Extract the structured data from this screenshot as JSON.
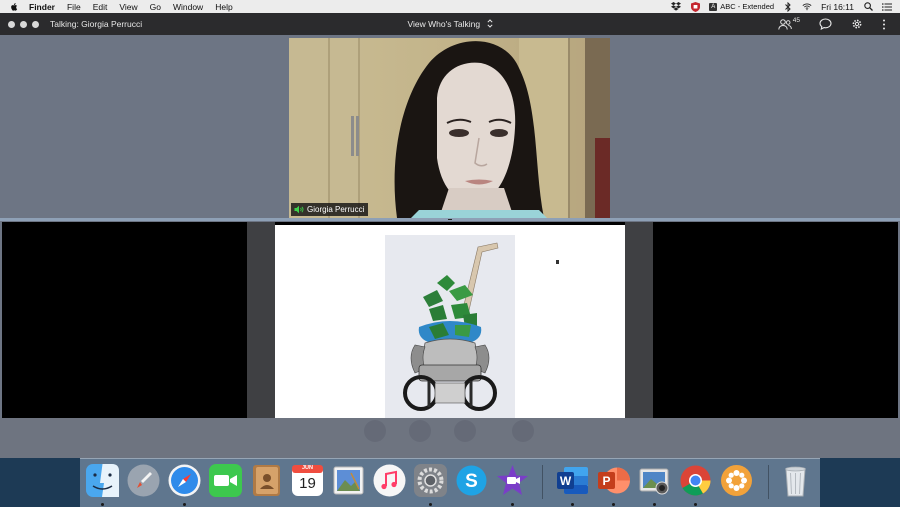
{
  "menubar": {
    "app_name": "Finder",
    "items": [
      "File",
      "Edit",
      "View",
      "Go",
      "Window",
      "Help"
    ],
    "input_source": "ABC - Extended",
    "input_badge": "A",
    "clock": "Fri 16:11"
  },
  "window": {
    "talking_label": "Talking: Giorgia Perrucci",
    "view_mode": "View Who's Talking",
    "participants_count": "45"
  },
  "speaker": {
    "name": "Giorgia Perrucci"
  },
  "calendar_icon": {
    "month": "JUN",
    "day": "19"
  },
  "colors": {
    "titlebar": "#2b2b2d",
    "window_bg": "#6d7584",
    "divider": "#8ea0b6",
    "speaking_green": "#3fd14b"
  },
  "dock": {
    "apps": [
      "finder-icon",
      "launchpad-icon",
      "safari-icon",
      "facetime-icon",
      "contacts-icon",
      "calendar-icon",
      "preview-icon",
      "music-icon",
      "system-preferences-icon",
      "skype-icon",
      "imovie-icon",
      "word-icon",
      "powerpoint-icon",
      "image-capture-icon",
      "chrome-icon",
      "slides-icon",
      "trash-icon"
    ]
  }
}
